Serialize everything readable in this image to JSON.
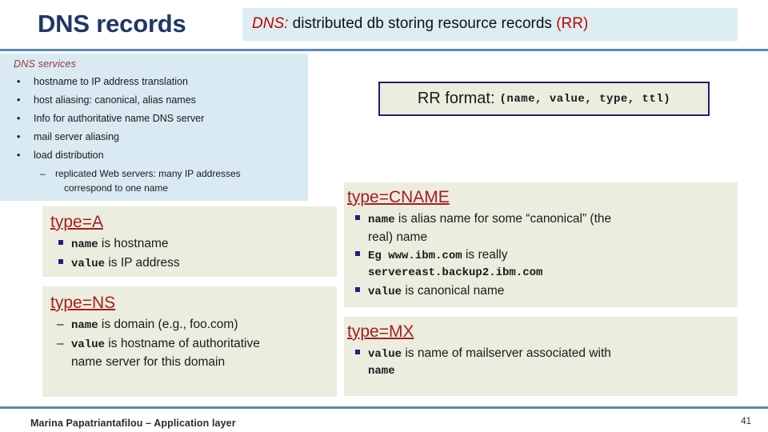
{
  "slide": {
    "title": "DNS records",
    "header_banner": {
      "lead": "DNS:",
      "middle": " distributed db storing resource records ",
      "tail": "(RR)"
    },
    "page_number": "41",
    "footer": "Marina Papatriantafilou – Application layer",
    "colors": {
      "title_navy": "#1f3864",
      "accent_red": "#c00000",
      "heading_red": "#a51d22",
      "banner_blue": "#ddeef2",
      "panel_blue": "#d9eaf2",
      "box_cream": "#ecedde",
      "rule_blue": "#5b8ab4",
      "bullet_navy": "#1f2080",
      "services_head_red": "#9e3440"
    }
  },
  "services_panel": {
    "heading": "DNS services",
    "bullet_glyph": "•",
    "dash_glyph": "–",
    "items": [
      "hostname to IP address translation",
      "host aliasing: canonical, alias names",
      "Info for authoritative name DNS server",
      "mail server aliasing",
      "load distribution"
    ],
    "sub_items": [
      {
        "line1": "replicated Web servers: many IP addresses",
        "line2": "correspond to one name"
      }
    ]
  },
  "rr_format": {
    "label": "RR format:",
    "signature": "(name, value, type, ttl)"
  },
  "records": [
    {
      "id": "type-a",
      "heading": "type=A",
      "bullet_style": "square",
      "bullets": [
        {
          "mono": "name",
          "rest": " is hostname"
        },
        {
          "mono": "value",
          "rest": " is IP address"
        }
      ]
    },
    {
      "id": "type-ns",
      "heading": "type=NS",
      "bullet_style": "dash",
      "bullets": [
        {
          "mono": "name",
          "rest": " is domain (e.g., foo.com)"
        },
        {
          "mono": "value",
          "rest": " is hostname of authoritative",
          "rest2": "name server for this domain"
        }
      ]
    },
    {
      "id": "type-cname",
      "heading": "type=CNAME",
      "bullet_style": "square",
      "bullets": [
        {
          "mono": "name",
          "rest": " is alias name for some “canonical” (the",
          "rest2": "real) name"
        },
        {
          "mono_lead": "Eg ",
          "mono": "www.ibm.com",
          "rest": " is really",
          "mono2": "servereast.backup2.ibm.com"
        },
        {
          "mono": "value",
          "rest": " is canonical name"
        }
      ]
    },
    {
      "id": "type-mx",
      "heading": "type=MX",
      "bullet_style": "square",
      "bullets": [
        {
          "mono": "value",
          "rest": " is name of mailserver associated with",
          "mono2": "name"
        }
      ]
    }
  ]
}
